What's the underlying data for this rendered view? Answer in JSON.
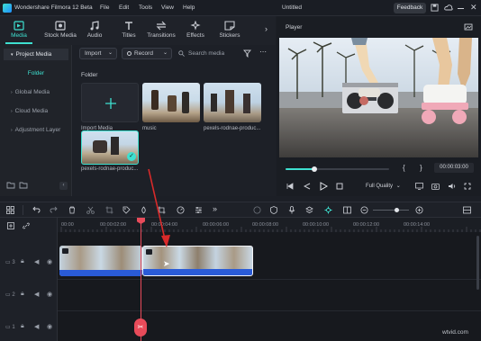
{
  "app": {
    "title": "Wondershare Filmora 12 Beta",
    "menu": [
      "File",
      "Edit",
      "Tools",
      "View",
      "Help"
    ],
    "project_name": "Untitled",
    "feedback_label": "Feedback"
  },
  "toolbar": {
    "tabs": [
      {
        "label": "Media",
        "icon": "media-icon",
        "active": true
      },
      {
        "label": "Stock Media",
        "icon": "stock-media-icon"
      },
      {
        "label": "Audio",
        "icon": "music-note-icon"
      },
      {
        "label": "Titles",
        "icon": "text-t-icon"
      },
      {
        "label": "Transitions",
        "icon": "transitions-icon"
      },
      {
        "label": "Effects",
        "icon": "effects-icon"
      },
      {
        "label": "Stickers",
        "icon": "stickers-icon"
      }
    ]
  },
  "sidebar": {
    "items": [
      {
        "label": "Project Media",
        "active": true
      },
      {
        "label": "Folder"
      },
      {
        "label": "Global Media"
      },
      {
        "label": "Cloud Media"
      },
      {
        "label": "Adjustment Layer"
      }
    ]
  },
  "media": {
    "import_label": "Import",
    "record_label": "Record",
    "search_placeholder": "Search media",
    "folder_label": "Folder",
    "items": [
      {
        "label": "Import Media"
      },
      {
        "label": "music"
      },
      {
        "label": "pexels-rodnae-produc..."
      },
      {
        "label": "pexels-rodnae-produc..."
      }
    ]
  },
  "player": {
    "label": "Player",
    "timecode": "00:00:03:00",
    "quality": "Full Quality",
    "progress": 0.28
  },
  "timeline": {
    "ticks": [
      "00:00",
      "00:00:02:00",
      "00:00:04:00",
      "00:00:06:00",
      "00:00:08:00",
      "00:00:10:00",
      "00:00:12:00",
      "00:00:14:00"
    ],
    "tracks": [
      "3",
      "2",
      "1"
    ]
  },
  "watermark": "wtvid.com",
  "colors": {
    "accent": "#3ee0d0",
    "playhead": "#e84b5a",
    "clip_bar": "#2a5bd7"
  }
}
